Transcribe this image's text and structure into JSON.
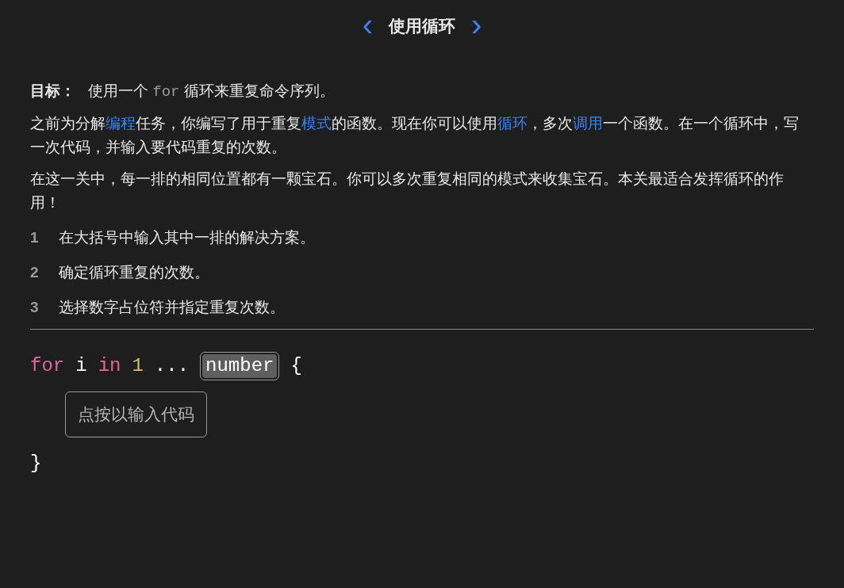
{
  "header": {
    "title": "使用循环",
    "prev_label": "‹",
    "next_label": "›"
  },
  "goal": {
    "label": "目标：",
    "segments": [
      {
        "kind": "plain",
        "text": "使用一个 "
      },
      {
        "kind": "code",
        "text": "for"
      },
      {
        "kind": "plain",
        "text": " 循环来重复命令序列。"
      }
    ]
  },
  "paragraphs": [
    [
      {
        "kind": "plain",
        "text": "之前为分解"
      },
      {
        "kind": "link",
        "text": "编程"
      },
      {
        "kind": "plain",
        "text": "任务，你编写了用于重复"
      },
      {
        "kind": "link",
        "text": "模式"
      },
      {
        "kind": "plain",
        "text": "的函数。现在你可以使用"
      },
      {
        "kind": "link",
        "text": "循环"
      },
      {
        "kind": "plain",
        "text": "，多次"
      },
      {
        "kind": "link",
        "text": "调用"
      },
      {
        "kind": "plain",
        "text": "一个函数。在一个循环中，写一次代码，并输入要代码重复的次数。"
      }
    ],
    [
      {
        "kind": "plain",
        "text": "在这一关中，每一排的相同位置都有一颗宝石。你可以多次重复相同的模式来收集宝石。本关最适合发挥循环的作用！"
      }
    ]
  ],
  "steps": [
    {
      "number": "1",
      "text": "在大括号中输入其中一排的解决方案。"
    },
    {
      "number": "2",
      "text": "确定循环重复的次数。"
    },
    {
      "number": "3",
      "text": "选择数字占位符并指定重复次数。"
    }
  ],
  "code": {
    "tokens": [
      {
        "kind": "keyword",
        "text": "for"
      },
      {
        "kind": "plain",
        "text": "i"
      },
      {
        "kind": "keyword",
        "text": "in"
      },
      {
        "kind": "number",
        "text": "1"
      },
      {
        "kind": "plain",
        "text": "..."
      },
      {
        "kind": "placeholder",
        "text": "number",
        "selected": true
      },
      {
        "kind": "plain",
        "text": "{"
      }
    ],
    "body_placeholder": "点按以输入代码",
    "closing": "}"
  }
}
